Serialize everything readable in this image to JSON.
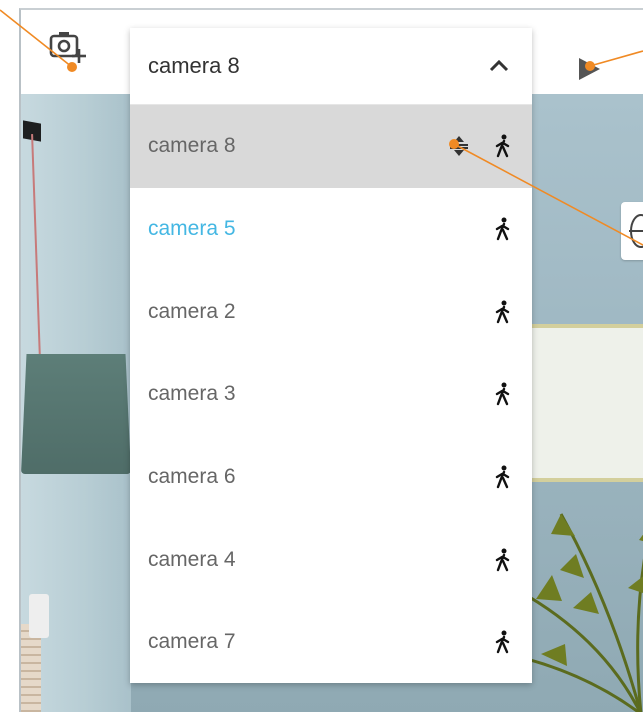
{
  "dropdown": {
    "selected": "camera 8",
    "items": [
      {
        "name": "camera 8"
      },
      {
        "name": "camera 5"
      },
      {
        "name": "camera 2"
      },
      {
        "name": "camera 3"
      },
      {
        "name": "camera 6"
      },
      {
        "name": "camera 4"
      },
      {
        "name": "camera 7"
      }
    ]
  },
  "colors": {
    "accent": "#44b7e3",
    "annotation": "#f08a24",
    "hover_bg": "#d9d9d9"
  },
  "icons": {
    "add_camera": "camera-add-icon",
    "play": "play-icon",
    "chevron": "chevron-up-icon",
    "walk": "walk-icon",
    "reorder": "reorder-icon",
    "orbit": "orbit-icon"
  }
}
